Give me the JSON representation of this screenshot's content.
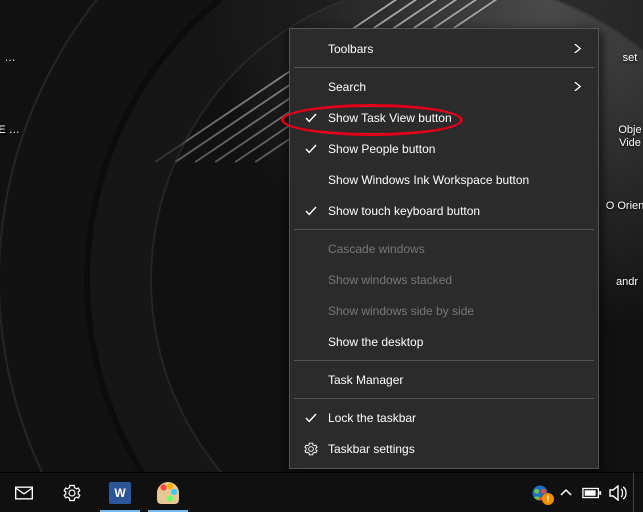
{
  "menu": {
    "toolbars": "Toolbars",
    "search": "Search",
    "show_task_view": "Show Task View button",
    "show_people": "Show People button",
    "show_ink": "Show Windows Ink Workspace button",
    "show_touch_kb": "Show touch keyboard button",
    "cascade": "Cascade windows",
    "stacked": "Show windows stacked",
    "sidebyside": "Show windows side by side",
    "show_desktop": "Show the desktop",
    "task_manager": "Task Manager",
    "lock_taskbar": "Lock the taskbar",
    "taskbar_settings": "Taskbar settings"
  },
  "desktop_labels": {
    "left1": "…",
    "left2": "E\n…",
    "right1": "set",
    "right2": "Obje\nVide",
    "right3": "O\nOrien",
    "right4": "andr"
  },
  "taskbar": {
    "word_label": "W",
    "action_badge": "!"
  }
}
